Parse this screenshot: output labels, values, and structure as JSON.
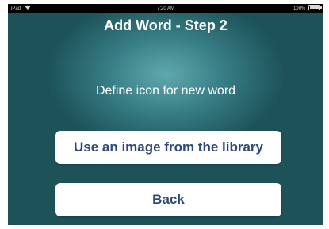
{
  "status_bar": {
    "device": "iPad",
    "time": "7:20 AM",
    "battery": "100%"
  },
  "header": {
    "title": "Add Word - Step 2"
  },
  "main": {
    "prompt": "Define icon for new word",
    "library_button_label": "Use an image from the library",
    "back_button_label": "Back"
  },
  "icons": {
    "wifi": "wifi-icon",
    "battery": "battery-icon"
  },
  "colors": {
    "background_center": "#5fa9ad",
    "background_edge": "#1c5258",
    "button_text": "#2f4a7a",
    "button_background": "#ffffff"
  }
}
